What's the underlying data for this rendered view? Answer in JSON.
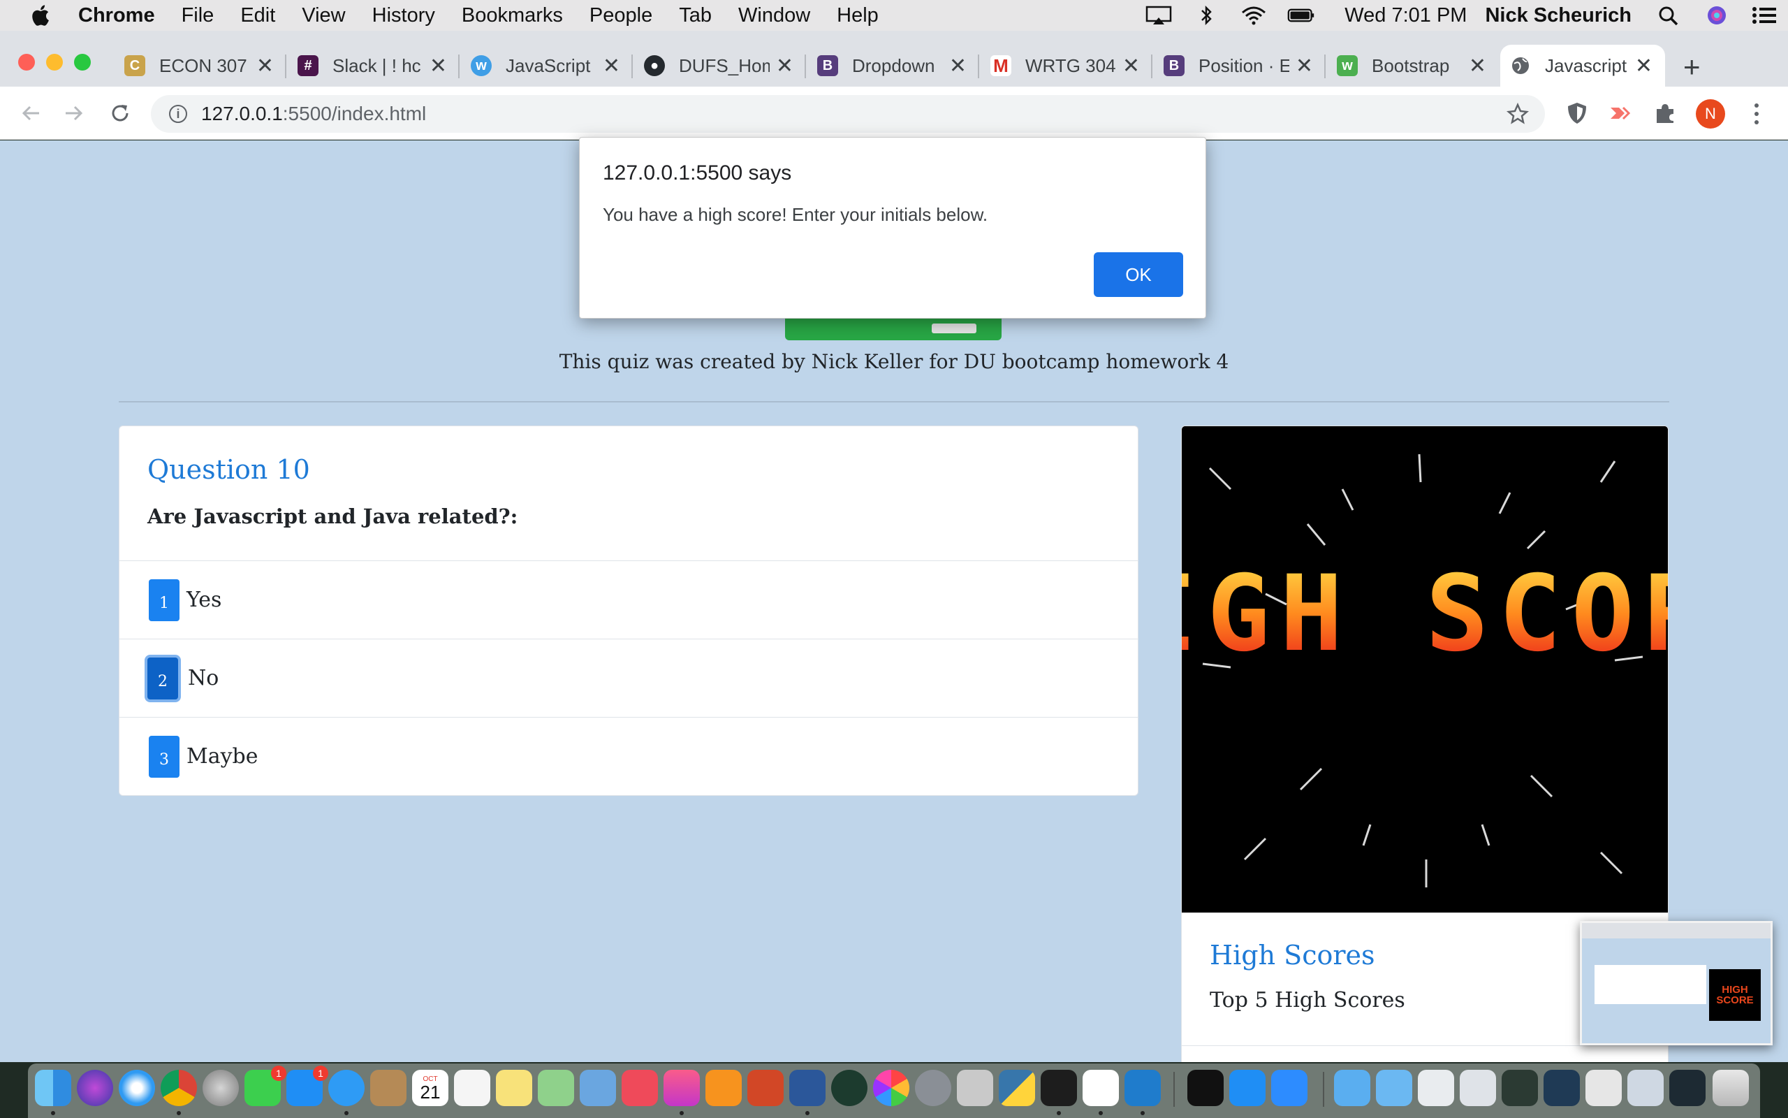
{
  "menubar": {
    "app_name": "Chrome",
    "menus": [
      "File",
      "Edit",
      "View",
      "History",
      "Bookmarks",
      "People",
      "Tab",
      "Window",
      "Help"
    ],
    "clock": "Wed 7:01 PM",
    "user": "Nick Scheurich"
  },
  "tabs": [
    {
      "label": "ECON 307",
      "favicon": "colorado-logo-icon",
      "color": "#c9a34b"
    },
    {
      "label": "Slack | ! hc",
      "favicon": "slack-icon",
      "color": "#4a154b"
    },
    {
      "label": "JavaScript",
      "favicon": "w3-icon",
      "color": "#3f9ee6"
    },
    {
      "label": "DUFS_Hom",
      "favicon": "github-icon",
      "color": "#24292e"
    },
    {
      "label": "Dropdown",
      "favicon": "bootstrap-icon",
      "color": "#563d7c"
    },
    {
      "label": "WRTG 304",
      "favicon": "gmail-icon",
      "color": "#d93025"
    },
    {
      "label": "Position · E",
      "favicon": "bootstrap-icon",
      "color": "#563d7c"
    },
    {
      "label": "Bootstrap",
      "favicon": "w3-green-icon",
      "color": "#4caf50"
    },
    {
      "label": "Javascript",
      "favicon": "globe-icon",
      "color": "#5f6368"
    }
  ],
  "toolbar": {
    "url_host": "127.0.0.1",
    "url_path": ":5500/index.html",
    "profile_initial": "N"
  },
  "dialog": {
    "title": "127.0.0.1:5500 says",
    "message": "You have a high score! Enter your initials below.",
    "ok_label": "OK"
  },
  "page": {
    "credit": "This quiz was created by Nick Keller for DU bootcamp homework 4",
    "question": {
      "title": "Question 10",
      "text": "Are Javascript and Java related?:",
      "answers": [
        {
          "num": "1",
          "label": "Yes"
        },
        {
          "num": "2",
          "label": "No"
        },
        {
          "num": "3",
          "label": "Maybe"
        }
      ]
    },
    "scores": {
      "image_text": "HIGH SCORE",
      "title": "High Scores",
      "subtitle": "Top 5 High Scores"
    }
  },
  "dock": {
    "calendar_month": "OCT",
    "calendar_day": "21",
    "facetime_badge": "1",
    "appstore_badge": "1"
  },
  "colors": {
    "page_bg": "#bfd5ea",
    "accent_blue": "#1a82f0",
    "link_blue": "#1e7ad6",
    "start_green": "#28a745",
    "dialog_ok": "#1a73e8"
  }
}
